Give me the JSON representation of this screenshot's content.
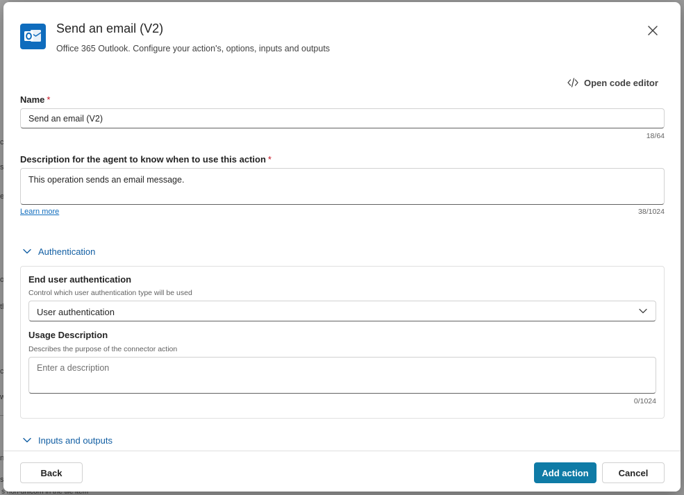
{
  "background": {
    "fragments": [
      "c",
      "s",
      "es",
      "oc",
      "th",
      "c",
      "w",
      "n",
      "s",
      "s non-unicorn in the tile item"
    ]
  },
  "dialog": {
    "title": "Send an email (V2)",
    "subtitle": "Office 365 Outlook. Configure your action's, options, inputs and outputs",
    "app_icon": "outlook-icon",
    "close_icon": "close-icon"
  },
  "toolbar": {
    "code_editor_label": "Open code editor",
    "code_editor_icon": "code-icon"
  },
  "name_field": {
    "label": "Name",
    "required_mark": "*",
    "value": "Send an email (V2)",
    "counter": "18/64"
  },
  "description_field": {
    "label": "Description for the agent to know when to use this action",
    "required_mark": "*",
    "value": "This operation sends an email message.",
    "counter": "38/1024",
    "learn_more": "Learn more"
  },
  "authentication": {
    "section_label": "Authentication",
    "expanded": true,
    "end_user_label": "End user authentication",
    "end_user_hint": "Control which user authentication type will be used",
    "selected_option": "User authentication",
    "usage_label": "Usage Description",
    "usage_hint": "Describes the purpose of the connector action",
    "usage_placeholder": "Enter a description",
    "usage_value": "",
    "usage_counter": "0/1024"
  },
  "inputs_outputs": {
    "section_label": "Inputs and outputs",
    "expanded": true
  },
  "footer": {
    "back_label": "Back",
    "add_action_label": "Add action",
    "cancel_label": "Cancel"
  },
  "colors": {
    "primary_button": "#0f7ba6",
    "section_link": "#115ea3",
    "required": "#c50f1f",
    "outlook_blue": "#0f6cbd"
  }
}
